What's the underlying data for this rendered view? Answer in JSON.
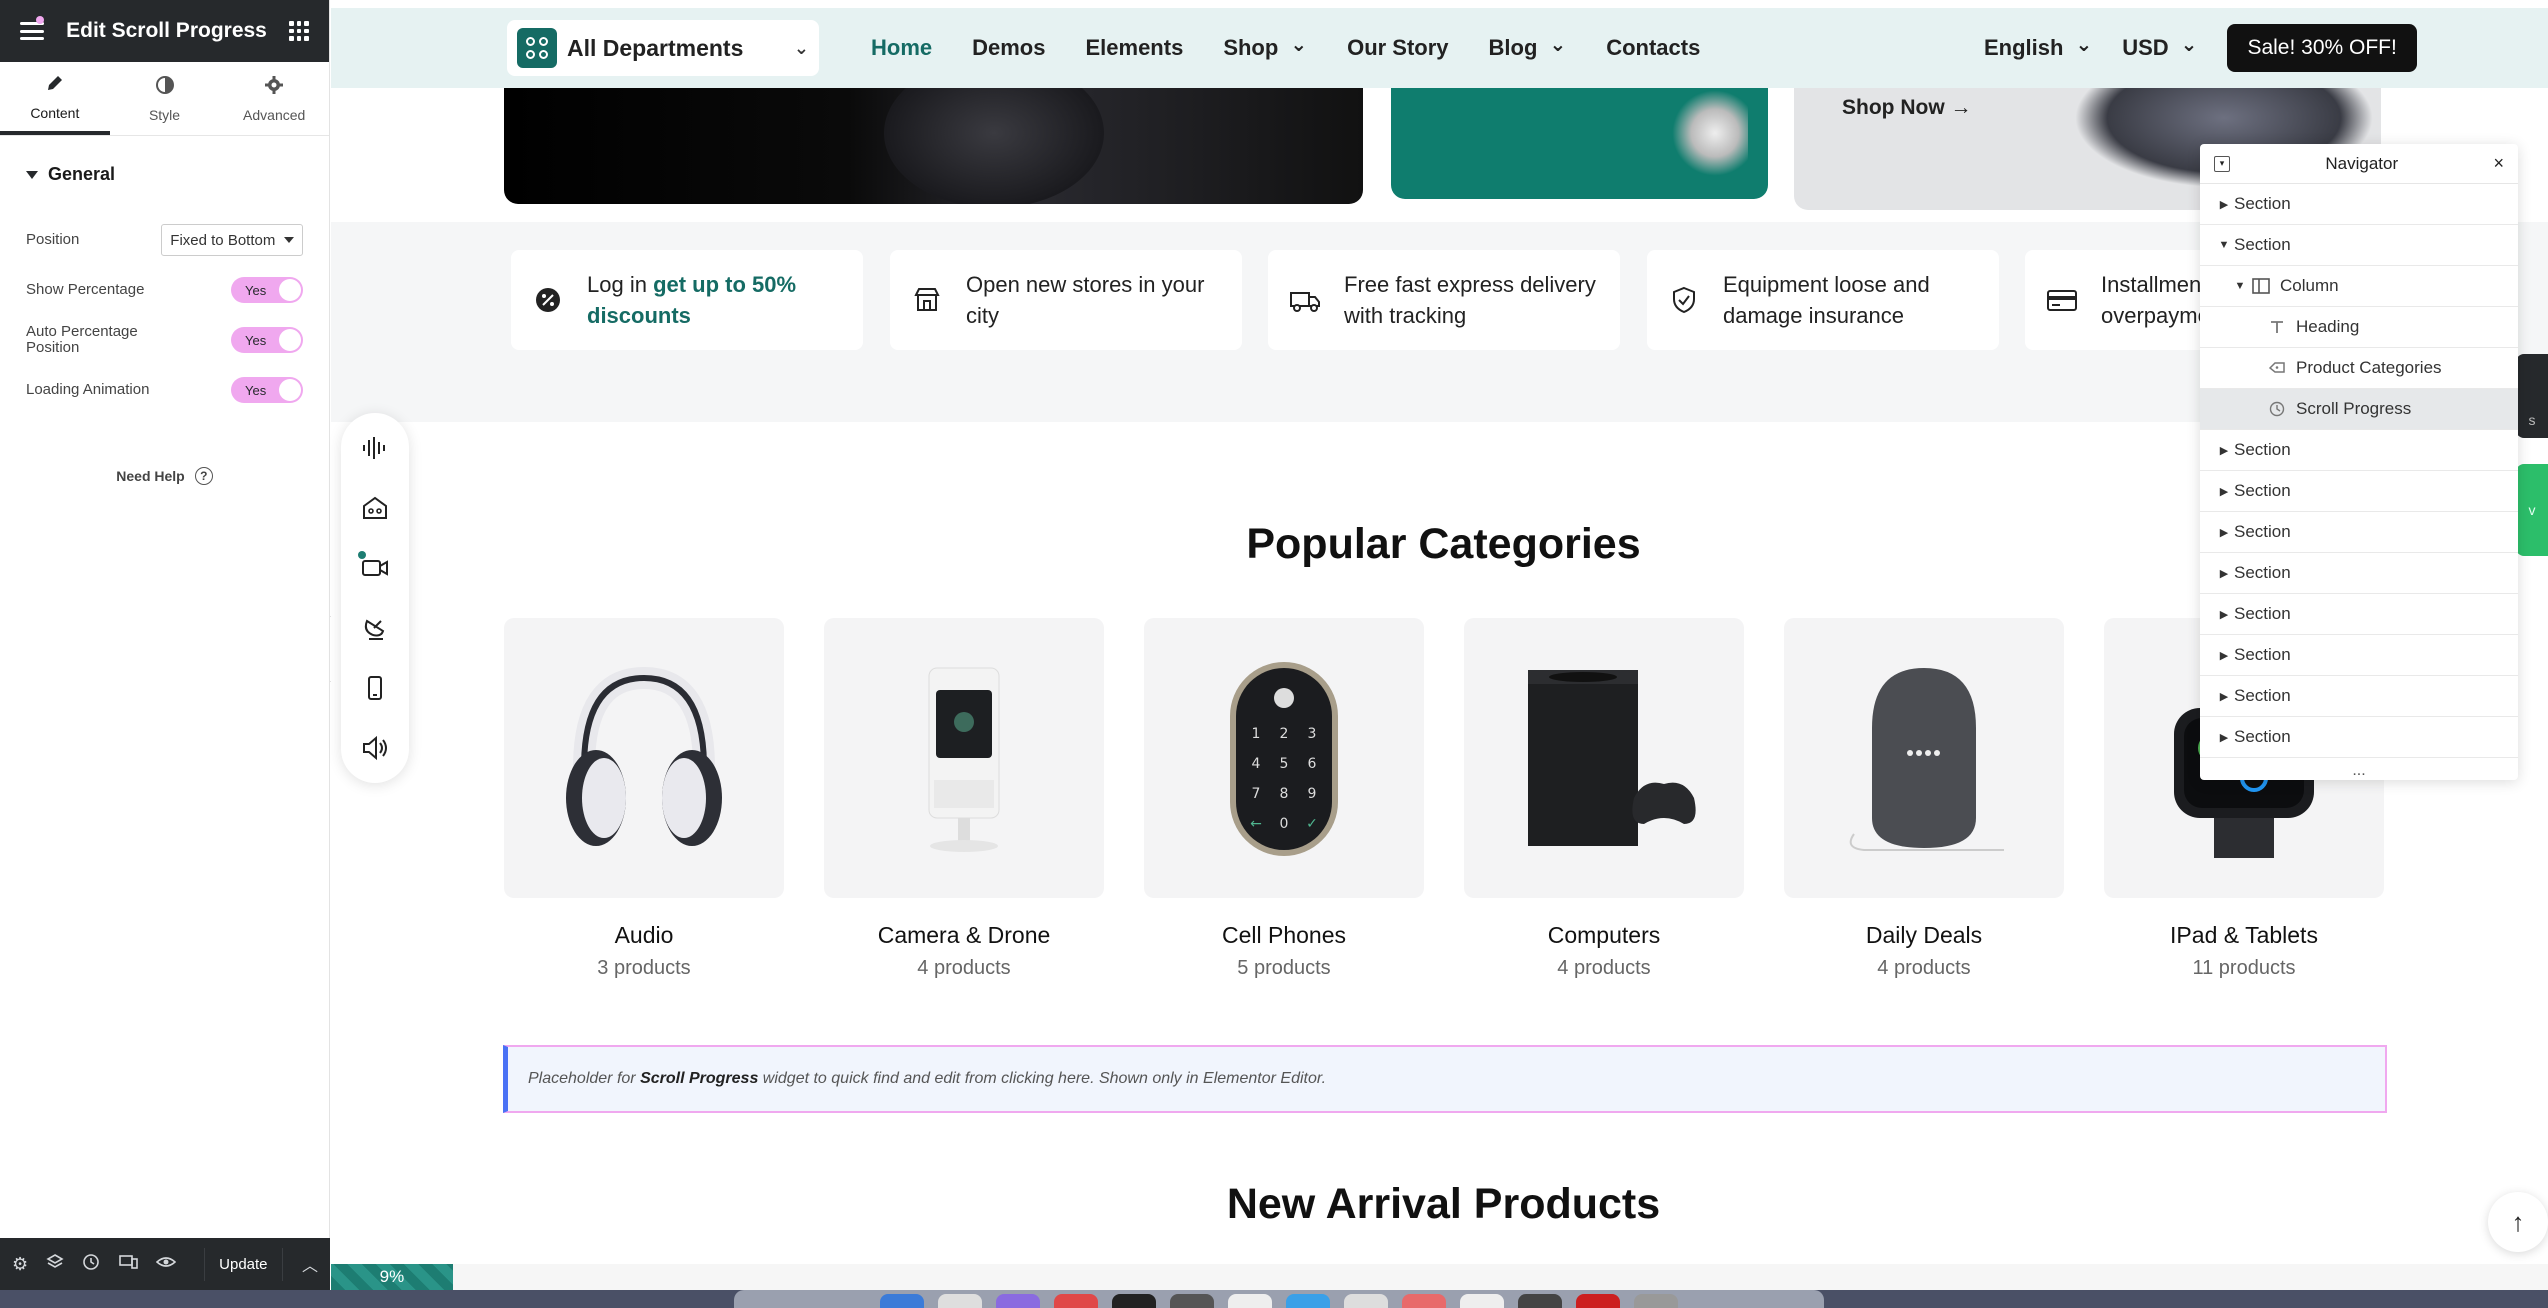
{
  "panel": {
    "title": "Edit Scroll Progress",
    "tabs": [
      {
        "label": "Content",
        "icon": "pencil-icon"
      },
      {
        "label": "Style",
        "icon": "contrast-icon"
      },
      {
        "label": "Advanced",
        "icon": "gear-icon"
      }
    ],
    "section_title": "General",
    "controls": {
      "position_label": "Position",
      "position_value": "Fixed to Bottom",
      "show_percentage_label": "Show Percentage",
      "show_percentage_value": "Yes",
      "auto_percentage_label": "Auto Percentage Position",
      "auto_percentage_value": "Yes",
      "loading_animation_label": "Loading Animation",
      "loading_animation_value": "Yes"
    },
    "need_help": "Need Help",
    "footer": {
      "update_label": "Update"
    }
  },
  "site": {
    "departments_label": "All Departments",
    "nav": [
      "Home",
      "Demos",
      "Elements",
      "Shop",
      "Our Story",
      "Blog",
      "Contacts"
    ],
    "language": "English",
    "currency": "USD",
    "sale_label": "Sale! 30% OFF!",
    "banner_shop_now": "Shop Now →"
  },
  "features": [
    {
      "text": "Log in ",
      "highlight": "get up to 50% discounts",
      "icon": "discount-badge-icon"
    },
    {
      "text": "Open new stores in your city",
      "icon": "store-icon"
    },
    {
      "text": "Free fast express delivery with tracking",
      "icon": "truck-icon"
    },
    {
      "text": "Equipment loose and damage insurance",
      "icon": "shield-check-icon"
    },
    {
      "text": "Installments without overpayments",
      "icon": "credit-card-icon"
    }
  ],
  "popular_title": "Popular Categories",
  "categories": [
    {
      "name": "Audio",
      "count": "3 products"
    },
    {
      "name": "Camera & Drone",
      "count": "4 products"
    },
    {
      "name": "Cell Phones",
      "count": "5 products"
    },
    {
      "name": "Computers",
      "count": "4 products"
    },
    {
      "name": "Daily Deals",
      "count": "4 products"
    },
    {
      "name": "IPad & Tablets",
      "count": "11 products"
    }
  ],
  "placeholder": {
    "prefix": "Placeholder for ",
    "widget": "Scroll Progress",
    "suffix": " widget to quick find and edit from clicking here. Shown only in Elementor Editor."
  },
  "new_arrivals_title": "New Arrival Products",
  "progress": {
    "percent_label": "9%",
    "fraction": 0.055
  },
  "navigator": {
    "title": "Navigator",
    "rows": [
      {
        "label": "Section",
        "level": 0,
        "state": "collapsed"
      },
      {
        "label": "Section",
        "level": 0,
        "state": "expanded"
      },
      {
        "label": "Column",
        "level": 1,
        "state": "expanded",
        "icon": "column-icon"
      },
      {
        "label": "Heading",
        "level": 2,
        "icon": "heading-icon"
      },
      {
        "label": "Product Categories",
        "level": 2,
        "icon": "categories-icon"
      },
      {
        "label": "Scroll Progress",
        "level": 2,
        "icon": "scroll-progress-icon",
        "selected": true
      },
      {
        "label": "Section",
        "level": 0,
        "state": "collapsed"
      },
      {
        "label": "Section",
        "level": 0,
        "state": "collapsed"
      },
      {
        "label": "Section",
        "level": 0,
        "state": "collapsed"
      },
      {
        "label": "Section",
        "level": 0,
        "state": "collapsed"
      },
      {
        "label": "Section",
        "level": 0,
        "state": "collapsed"
      },
      {
        "label": "Section",
        "level": 0,
        "state": "collapsed"
      },
      {
        "label": "Section",
        "level": 0,
        "state": "collapsed"
      },
      {
        "label": "Section",
        "level": 0,
        "state": "collapsed"
      }
    ],
    "more": "..."
  },
  "colors": {
    "brand_teal": "#156b64",
    "editor_dark": "#26292c",
    "toggle_pink": "#f0a8ef",
    "placeholder_blue": "#4a72f5"
  }
}
